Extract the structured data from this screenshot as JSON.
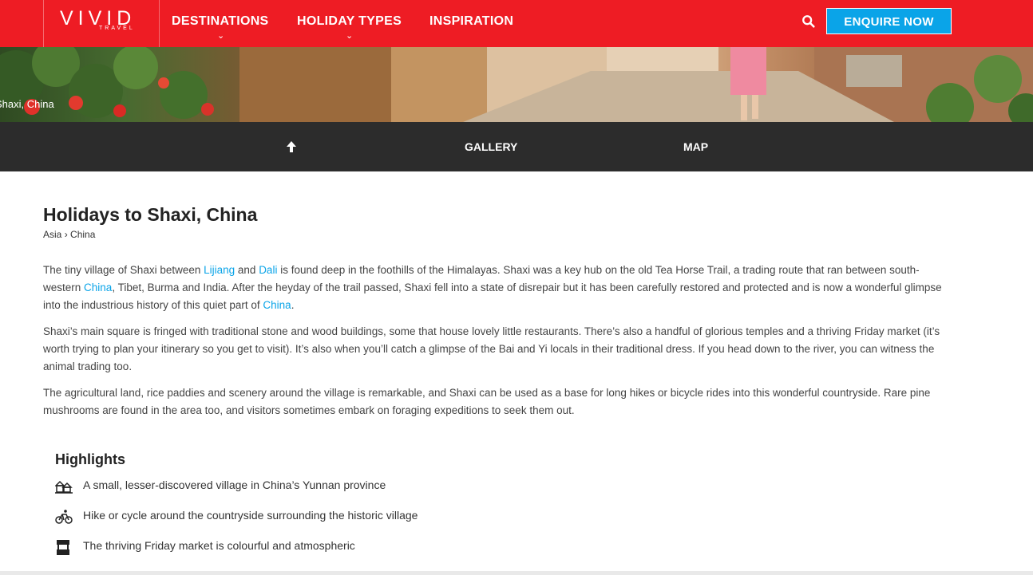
{
  "header": {
    "logo_main": "VIVID",
    "logo_sub": "TRAVEL",
    "nav": [
      "DESTINATIONS",
      "HOLIDAY TYPES",
      "INSPIRATION"
    ],
    "enquire_label": "ENQUIRE NOW",
    "search_icon": "search-icon",
    "brand_color": "#ee1c24",
    "accent_color": "#0aa4e8"
  },
  "hero": {
    "caption": "Shaxi, China"
  },
  "subnav": {
    "top_icon": "arrow-up-icon",
    "gallery": "GALLERY",
    "map": "MAP"
  },
  "main": {
    "title": "Holidays to Shaxi, China",
    "breadcrumb": {
      "region": "Asia",
      "separator": "›",
      "country": "China"
    },
    "p1": {
      "t1": "The tiny village of Shaxi between ",
      "link_lijiang": "Lijiang",
      "t2": " and ",
      "link_dali": "Dali",
      "t3": " is found deep in the foothills of the Himalayas. Shaxi was a key hub on the old Tea Horse Trail, a trading route that ran between south-western ",
      "link_china1": "China",
      "t4": ", Tibet, Burma and India. After the heyday of the trail passed, Shaxi fell into a state of disrepair but it has been carefully restored and protected and is now a wonderful glimpse into the industrious history of this quiet part of ",
      "link_china2": "China",
      "t5": "."
    },
    "p2": "Shaxi’s main square is fringed with traditional stone and wood buildings, some that house lovely little restaurants. There’s also a handful of glorious temples and a thriving Friday market (it’s worth trying to plan your itinerary so you get to visit). It’s also when you’ll catch a glimpse of the Bai and Yi locals in their traditional dress. If you head down to the river, you can witness the animal trading too.",
    "p3": "The agricultural land, rice paddies and scenery around the village is remarkable, and Shaxi can be used as a base for long hikes or bicycle rides into this wonderful countryside. Rare pine mushrooms are found in the area too, and visitors sometimes embark on foraging expeditions to seek them out."
  },
  "highlights": {
    "title": "Highlights",
    "items": [
      {
        "icon": "village-icon",
        "text": "A small, lesser-discovered village in China’s Yunnan province"
      },
      {
        "icon": "bicycle-icon",
        "text": "Hike or cycle around the countryside surrounding the historic village"
      },
      {
        "icon": "market-stall-icon",
        "text": "The thriving Friday market is colourful and atmospheric"
      }
    ]
  }
}
